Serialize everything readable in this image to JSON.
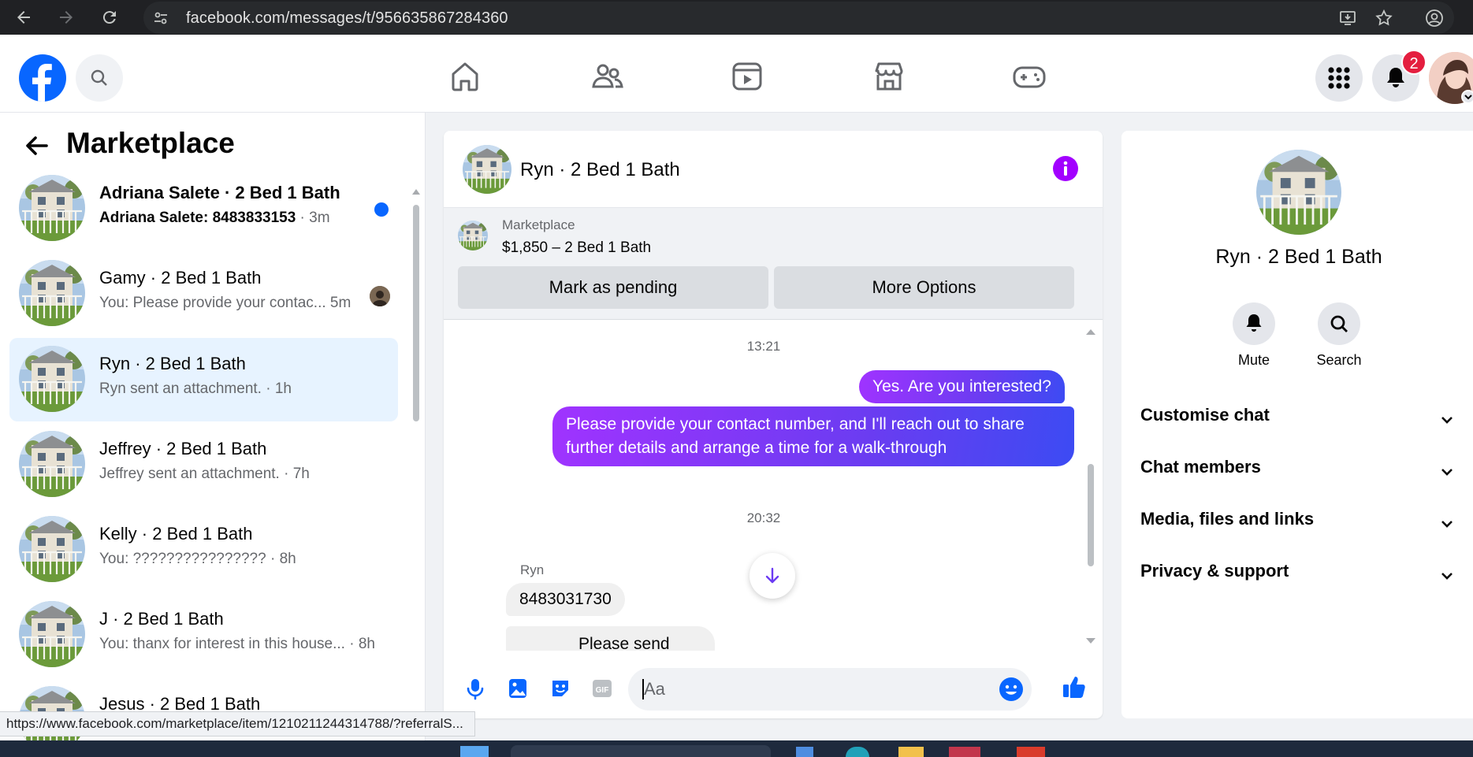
{
  "browser": {
    "url": "facebook.com/messages/t/956635867284360",
    "icons": [
      "back-icon",
      "forward-icon",
      "reload-icon",
      "site-info-icon",
      "install-app-icon",
      "bookmark-star-icon",
      "profile-icon"
    ]
  },
  "fb_nav": {
    "logo_letter": "f",
    "notification_count": "2",
    "brand_color": "#0866ff",
    "tabs": [
      "home",
      "friends",
      "video",
      "marketplace",
      "gaming"
    ]
  },
  "left_panel": {
    "title": "Marketplace",
    "conversations": [
      {
        "name": "Adriana Salete · 2 Bed 1 Bath",
        "preview": "Adriana Salete: 8483833153",
        "time": " · 3m",
        "unread": true
      },
      {
        "name": "Gamy · 2 Bed 1 Bath",
        "preview": "You: Please provide your contac...",
        "time": "  5m"
      },
      {
        "name": "Ryn · 2 Bed 1 Bath",
        "preview": "Ryn sent an attachment.",
        "time": " · 1h",
        "active": true
      },
      {
        "name": "Jeffrey · 2 Bed 1 Bath",
        "preview": "Jeffrey sent an attachment.",
        "time": " · 7h"
      },
      {
        "name": "Kelly · 2 Bed 1 Bath",
        "preview": "You: ????????????????",
        "time": " · 8h"
      },
      {
        "name": "J · 2 Bed 1 Bath",
        "preview": "You: thanx for interest in this house...",
        "time": " · 8h"
      },
      {
        "name": "Jesus · 2 Bed 1 Bath",
        "preview": "",
        "time": ""
      }
    ]
  },
  "chat": {
    "title": "Ryn · 2 Bed 1 Bath",
    "listing_label": "Marketplace",
    "listing_price": "$1,850 – 2 Bed 1 Bath",
    "mark_pending": "Mark as pending",
    "more_options": "More Options",
    "timestamp_1": "13:21",
    "out_msg_1": "Yes. Are you interested?",
    "out_msg_2": "Please provide your contact number, and I'll reach out to share further details and arrange a time for a walk-through",
    "timestamp_2": "20:32",
    "sender_name": "Ryn",
    "in_msg_1": "8483031730",
    "in_msg_2_partial": "Please send",
    "input_placeholder": "Aa",
    "accent": "#7b3cf5"
  },
  "right_panel": {
    "title": "Ryn · 2 Bed 1 Bath",
    "mute": "Mute",
    "search": "Search",
    "sections": [
      "Customise chat",
      "Chat members",
      "Media, files and links",
      "Privacy & support"
    ]
  },
  "status_url": "https://www.facebook.com/marketplace/item/1210211244314788/?referralS..."
}
